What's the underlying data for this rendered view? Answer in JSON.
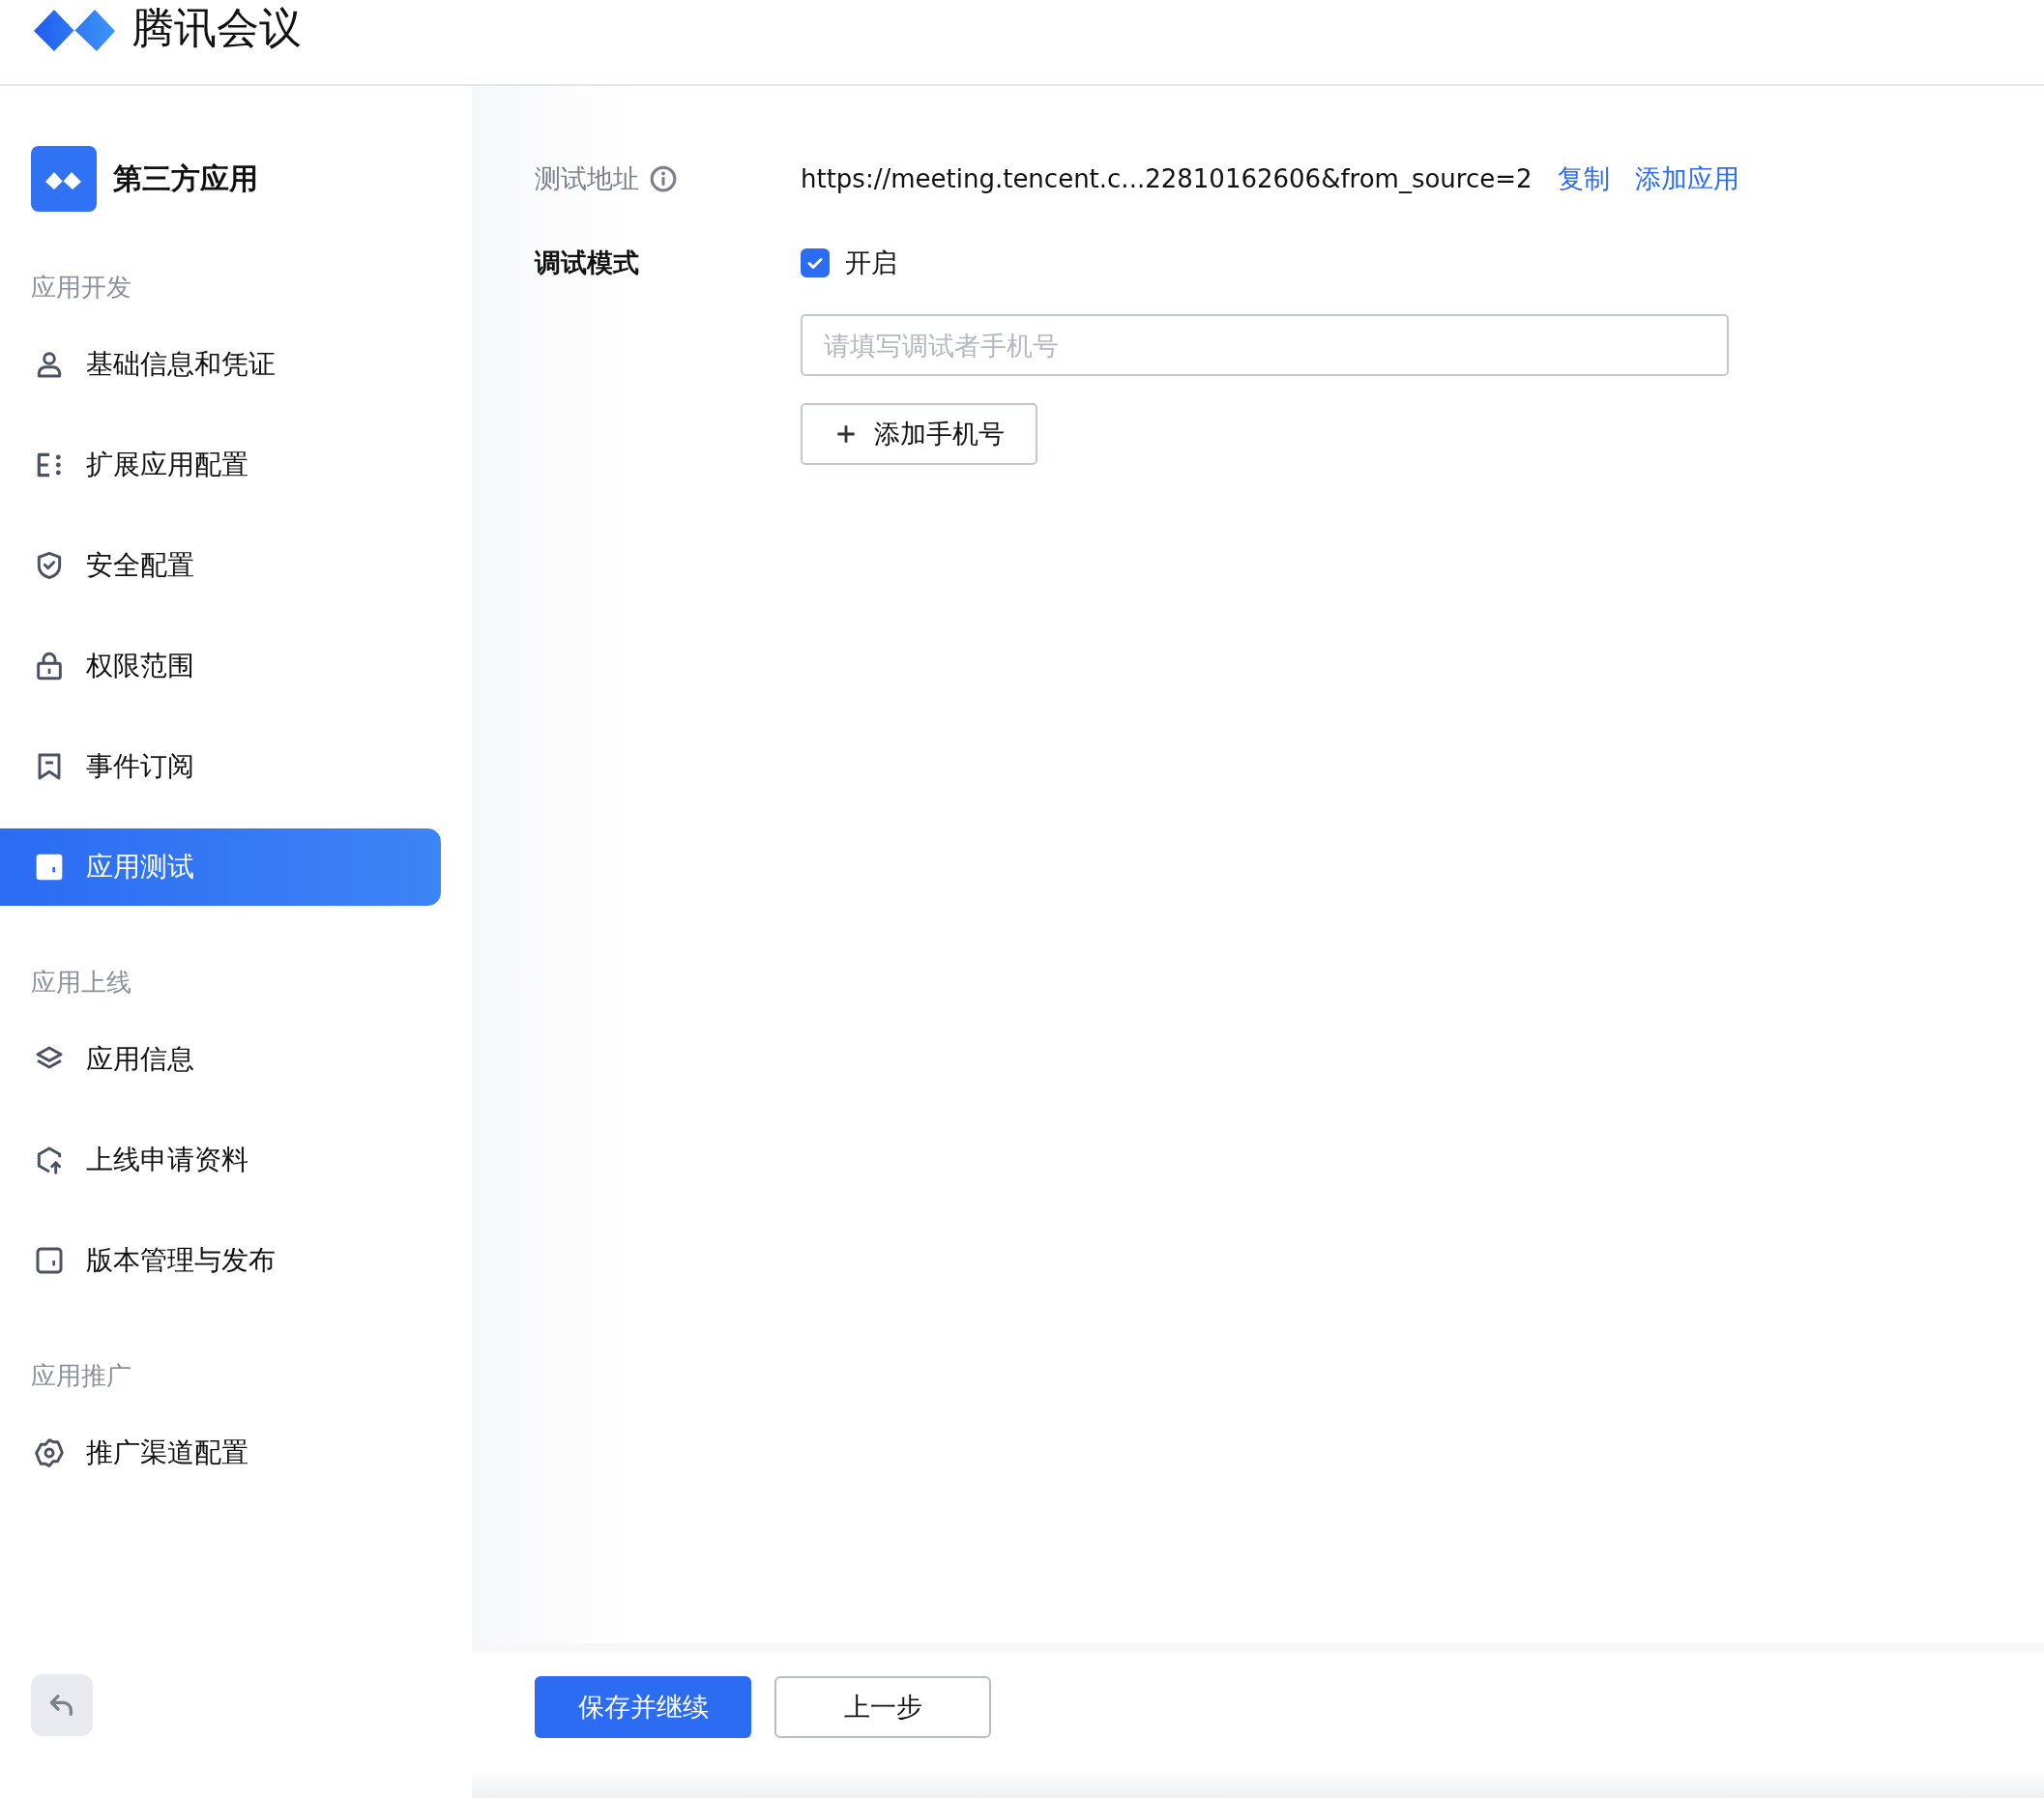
{
  "header": {
    "title": "腾讯会议"
  },
  "sidebar": {
    "app_title": "第三方应用",
    "sections": [
      {
        "title": "应用开发",
        "items": [
          {
            "label": "基础信息和凭证",
            "kind": "person",
            "selected": false
          },
          {
            "label": "扩展应用配置",
            "kind": "list",
            "selected": false
          },
          {
            "label": "安全配置",
            "kind": "shield",
            "selected": false
          },
          {
            "label": "权限范围",
            "kind": "lock",
            "selected": false
          },
          {
            "label": "事件订阅",
            "kind": "bookmark",
            "selected": false
          },
          {
            "label": "应用测试",
            "kind": "tablet",
            "selected": true
          }
        ]
      },
      {
        "title": "应用上线",
        "items": [
          {
            "label": "应用信息",
            "kind": "layers",
            "selected": false
          },
          {
            "label": "上线申请资料",
            "kind": "upload",
            "selected": false
          },
          {
            "label": "版本管理与发布",
            "kind": "tablet",
            "selected": false
          }
        ]
      },
      {
        "title": "应用推广",
        "items": [
          {
            "label": "推广渠道配置",
            "kind": "gear",
            "selected": false
          }
        ]
      }
    ]
  },
  "form": {
    "test_url": {
      "label": "测试地址",
      "value": "https://meeting.tencent.c...22810162606&from_source=2",
      "links": [
        "复制",
        "添加应用"
      ]
    },
    "debug_mode": {
      "label": "调试模式",
      "checkbox": {
        "label": "开启",
        "checked": true
      }
    },
    "phone_input": {
      "placeholder": "请填写调试者手机号"
    },
    "add_button": {
      "label": "添加手机号"
    }
  },
  "footer": {
    "buttons": [
      {
        "label": "保存并继续",
        "kind": "primary"
      },
      {
        "label": "上一步",
        "kind": "default"
      }
    ]
  }
}
